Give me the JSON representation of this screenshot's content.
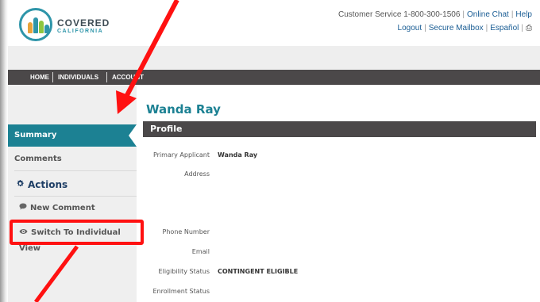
{
  "brand": {
    "line1": "COVERED",
    "line2": "CALIFORNIA"
  },
  "utility": {
    "customer_service": "Customer Service 1-800-300-1506",
    "online_chat": "Online Chat",
    "help": "Help",
    "logout": "Logout",
    "secure_mailbox": "Secure Mailbox",
    "espanol": "Español",
    "print_glyph": "⎙"
  },
  "nav": {
    "items": [
      "HOME",
      "INDIVIDUALS",
      "ACCOUNT"
    ]
  },
  "sidebar": {
    "summary": "Summary",
    "comments": "Comments",
    "actions_heading": "Actions",
    "new_comment": "New Comment",
    "switch_view": "Switch To Individual View"
  },
  "main": {
    "person_name": "Wanda Ray",
    "section_title": "Profile",
    "fields": [
      {
        "label": "Primary Applicant",
        "value": "Wanda Ray"
      },
      {
        "label": "Address",
        "value": ""
      },
      {
        "label": "Phone Number",
        "value": ""
      },
      {
        "label": "Email",
        "value": ""
      },
      {
        "label": "Eligibility Status",
        "value": "CONTINGENT ELIGIBLE"
      },
      {
        "label": "Enrollment Status",
        "value": ""
      }
    ]
  },
  "colors": {
    "teal": "#1c8193",
    "nav_dark": "#4b4849",
    "annotation_red": "#ff1111",
    "link_blue": "#1a5d94"
  },
  "icons": {
    "actions": "gear-icon",
    "new_comment": "speech-bubble-icon",
    "switch_view": "eye-icon",
    "print": "printer-icon"
  }
}
